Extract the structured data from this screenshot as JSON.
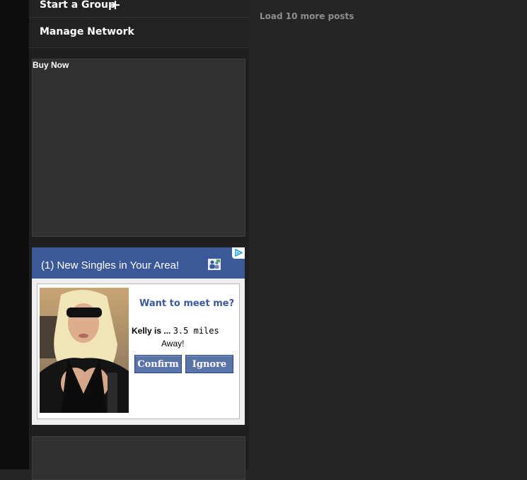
{
  "sidebar": {
    "start_group": "Start a Group",
    "start_group_icon": "plus-icon",
    "manage_network": "Manage Network"
  },
  "buy_box": {
    "label": "Buy Now"
  },
  "ad": {
    "title": "(1) New Singles in Your Area!",
    "header_icon": "people-icon",
    "choices_icon": "ad-choices-icon",
    "headline": "Want to meet me?",
    "name": "Kelly is ...",
    "distance": "3.5 miles",
    "away": "Away!",
    "confirm_label": "Confirm",
    "ignore_label": "Ignore",
    "accent_color": "#3b5998"
  },
  "main": {
    "load_more": "Load 10 more posts"
  }
}
